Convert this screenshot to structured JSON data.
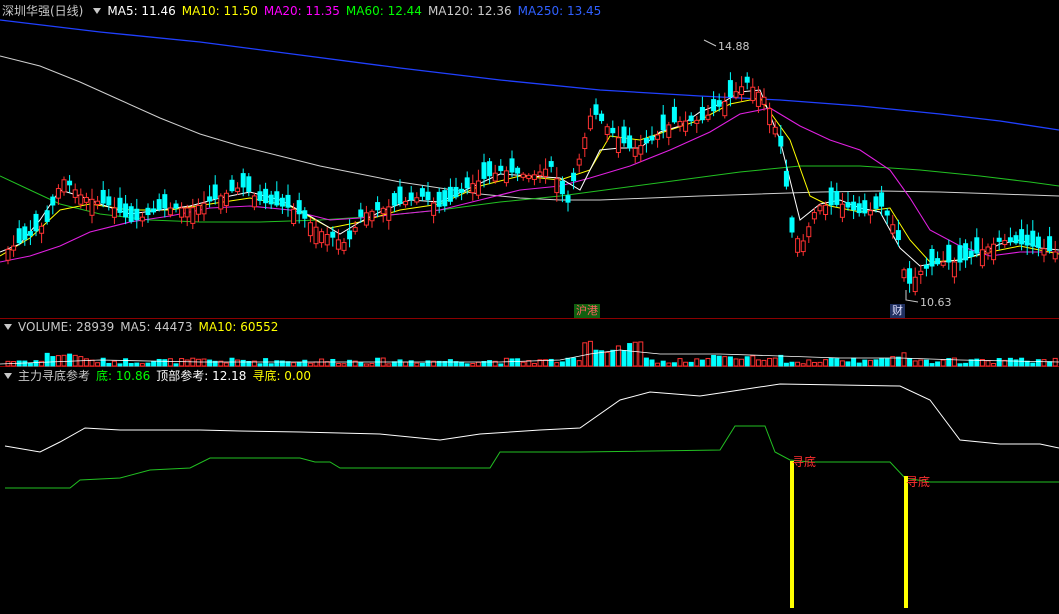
{
  "main": {
    "title": "深圳华强(日线)",
    "indicators": [
      {
        "label": "MA5: 11.46",
        "color": "#ffffff"
      },
      {
        "label": "MA10: 11.50",
        "color": "#ffff00"
      },
      {
        "label": "MA20: 11.35",
        "color": "#ff00ff"
      },
      {
        "label": "MA60: 12.44",
        "color": "#00ff00"
      },
      {
        "label": "MA120: 12.36",
        "color": "#c8c8c8"
      },
      {
        "label": "MA250: 13.45",
        "color": "#3060ff"
      }
    ],
    "high_label": "14.88",
    "low_label": "10.63",
    "tag_gangtong": "沪港",
    "tag_cai": "财"
  },
  "volume": {
    "legend": [
      {
        "label": "VOLUME: 28939",
        "color": "#c8c8c8"
      },
      {
        "label": "MA5: 44473",
        "color": "#c8c8c8"
      },
      {
        "label": "MA10: 60552",
        "color": "#ffff00"
      }
    ]
  },
  "indicator": {
    "name": "主力寻底参考",
    "legend": [
      {
        "label": "底: 10.86",
        "color": "#00ff00"
      },
      {
        "label": "顶部参考: 12.18",
        "color": "#ffffff"
      },
      {
        "label": "寻底: 0.00",
        "color": "#ffff00"
      }
    ],
    "signal_label_1": "寻底",
    "signal_label_2": "寻底"
  },
  "colors": {
    "up": "#ff3232",
    "down": "#00ffff",
    "bg": "#000000",
    "grid": "#8b0000"
  }
}
